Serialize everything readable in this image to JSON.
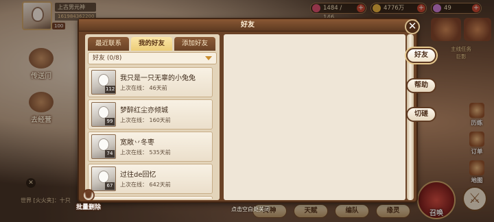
{
  "hud": {
    "player_name": "上古男元神",
    "player_id": "161984362200",
    "player_level": "100",
    "stamina": "1484 / 146",
    "gold": "4776万",
    "gems": "49"
  },
  "left_map": {
    "teleport_label": "传送门",
    "business_label": "去经营",
    "chat_preview": "世界 [火火夹]：十只",
    "close_symbol": "✕"
  },
  "batch_delete_label": "批量删除",
  "batch_delete_icon": "trash-icon",
  "panel": {
    "title": "好友",
    "close_symbol": "✕",
    "tabs": [
      {
        "label": "最近联系",
        "active": false
      },
      {
        "label": "我的好友",
        "active": true
      },
      {
        "label": "添加好友",
        "active": false
      }
    ],
    "group_select_value": "好友 (0/8)",
    "friends": [
      {
        "name": "我只是一只无辜的小兔兔",
        "level": "112",
        "last_online": "上次在线：  46天前"
      },
      {
        "name": "梦醉红尘亦倾城",
        "level": "99",
        "last_online": "上次在线：  160天前"
      },
      {
        "name": "宽敞丷冬枣",
        "level": "74",
        "last_online": "上次在线：  535天前"
      },
      {
        "name": "过往de回忆",
        "level": "67",
        "last_online": "上次在线：  642天前"
      },
      {
        "name": "",
        "level": "",
        "last_online": ""
      }
    ]
  },
  "side_tabs": [
    {
      "label": "好友",
      "active": true
    },
    {
      "label": "帮助",
      "active": false
    },
    {
      "label": "切磋",
      "active": false
    }
  ],
  "right_icons": {
    "main_quest_line1": "主线任务",
    "main_quest_line2": "巨影",
    "activity": "历练",
    "order": "订单",
    "map": "地图"
  },
  "bottom": {
    "hint": "点击空白处关闭",
    "buttons": [
      "阵神",
      "天赋",
      "编队",
      "缘灵"
    ],
    "summon": "召唤"
  },
  "colors": {
    "panel_frame": "#6a4226",
    "active_tab": "#eccd78",
    "accent_red": "#c2402c"
  }
}
